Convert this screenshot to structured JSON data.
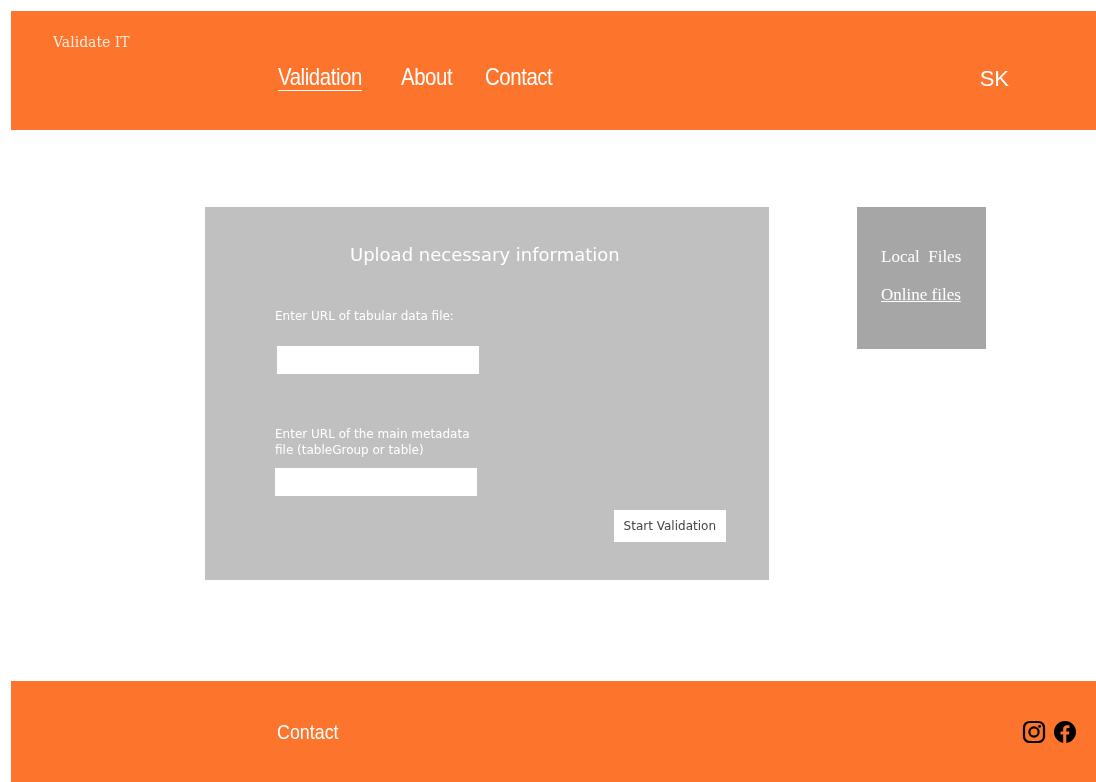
{
  "header": {
    "logo": "Validate IT",
    "nav": [
      {
        "label": "Validation",
        "selected": true
      },
      {
        "label": "About",
        "selected": false
      },
      {
        "label": "Contact",
        "selected": false
      }
    ],
    "user": "SK"
  },
  "upload": {
    "title": "Upload necessary information",
    "fields": [
      {
        "label": "Enter URL of tabular data file:"
      },
      {
        "label": "Enter URL of the main metadata file (tableGroup or table)"
      }
    ],
    "button": "Start Validation"
  },
  "source_menu": [
    {
      "label": "Local  Files",
      "selected": false
    },
    {
      "label": "Online files",
      "selected": true
    }
  ],
  "footer": {
    "link": "Contact"
  }
}
